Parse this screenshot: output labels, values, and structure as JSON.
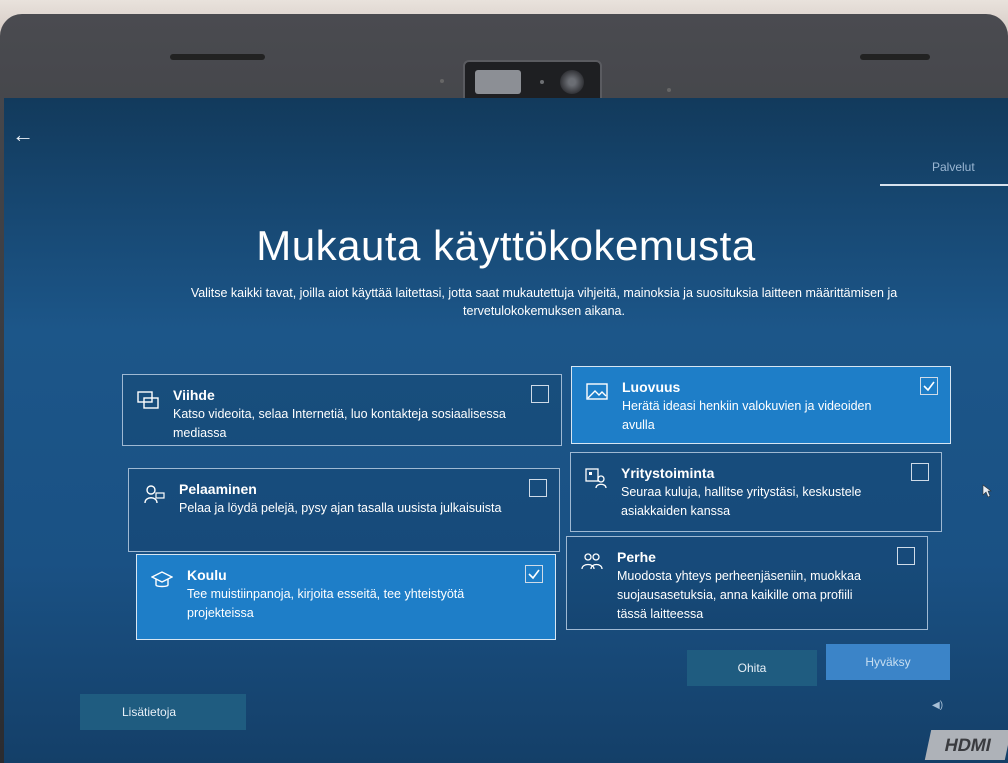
{
  "header": {
    "back_glyph": "←",
    "step_label": "Palvelut"
  },
  "main": {
    "title": "Mukauta käyttökokemusta",
    "subtitle": "Valitse kaikki tavat, joilla aiot käyttää laitettasi, jotta saat mukautettuja vihjeitä, mainoksia ja suosituksia laitteen määrittämisen ja tervetulokokemuksen aikana."
  },
  "options": [
    {
      "title": "Viihde",
      "description": "Katso videoita, selaa Internetiä, luo kontakteja sosiaalisessa mediassa",
      "checked": false,
      "icon": "entertainment-icon"
    },
    {
      "title": "Luovuus",
      "description": "Herätä ideasi henkiin valokuvien ja videoiden avulla",
      "checked": true,
      "icon": "creativity-icon"
    },
    {
      "title": "Pelaaminen",
      "description": "Pelaa ja löydä pelejä, pysy ajan tasalla uusista julkaisuista",
      "checked": false,
      "icon": "gaming-icon"
    },
    {
      "title": "Yritystoiminta",
      "description": "Seuraa kuluja, hallitse yritystäsi, keskustele asiakkaiden kanssa",
      "checked": false,
      "icon": "business-icon"
    },
    {
      "title": "Koulu",
      "description": "Tee muistiinpanoja, kirjoita esseitä, tee yhteistyötä projekteissa",
      "checked": true,
      "icon": "school-icon"
    },
    {
      "title": "Perhe",
      "description": "Muodosta yhteys perheenjäseniin, muokkaa suojausasetuksia, anna kaikille oma profiili tässä laitteessa",
      "checked": false,
      "icon": "family-icon"
    }
  ],
  "footer": {
    "skip_label": "Ohita",
    "accept_label": "Hyväksy",
    "more_info_label": "Lisätietoja"
  },
  "hardware": {
    "hdmi_label": "HDMI"
  },
  "colors": {
    "accent": "#1e7ec8",
    "screen_bg": "#1c5689",
    "button_bg": "#1f5c80"
  }
}
